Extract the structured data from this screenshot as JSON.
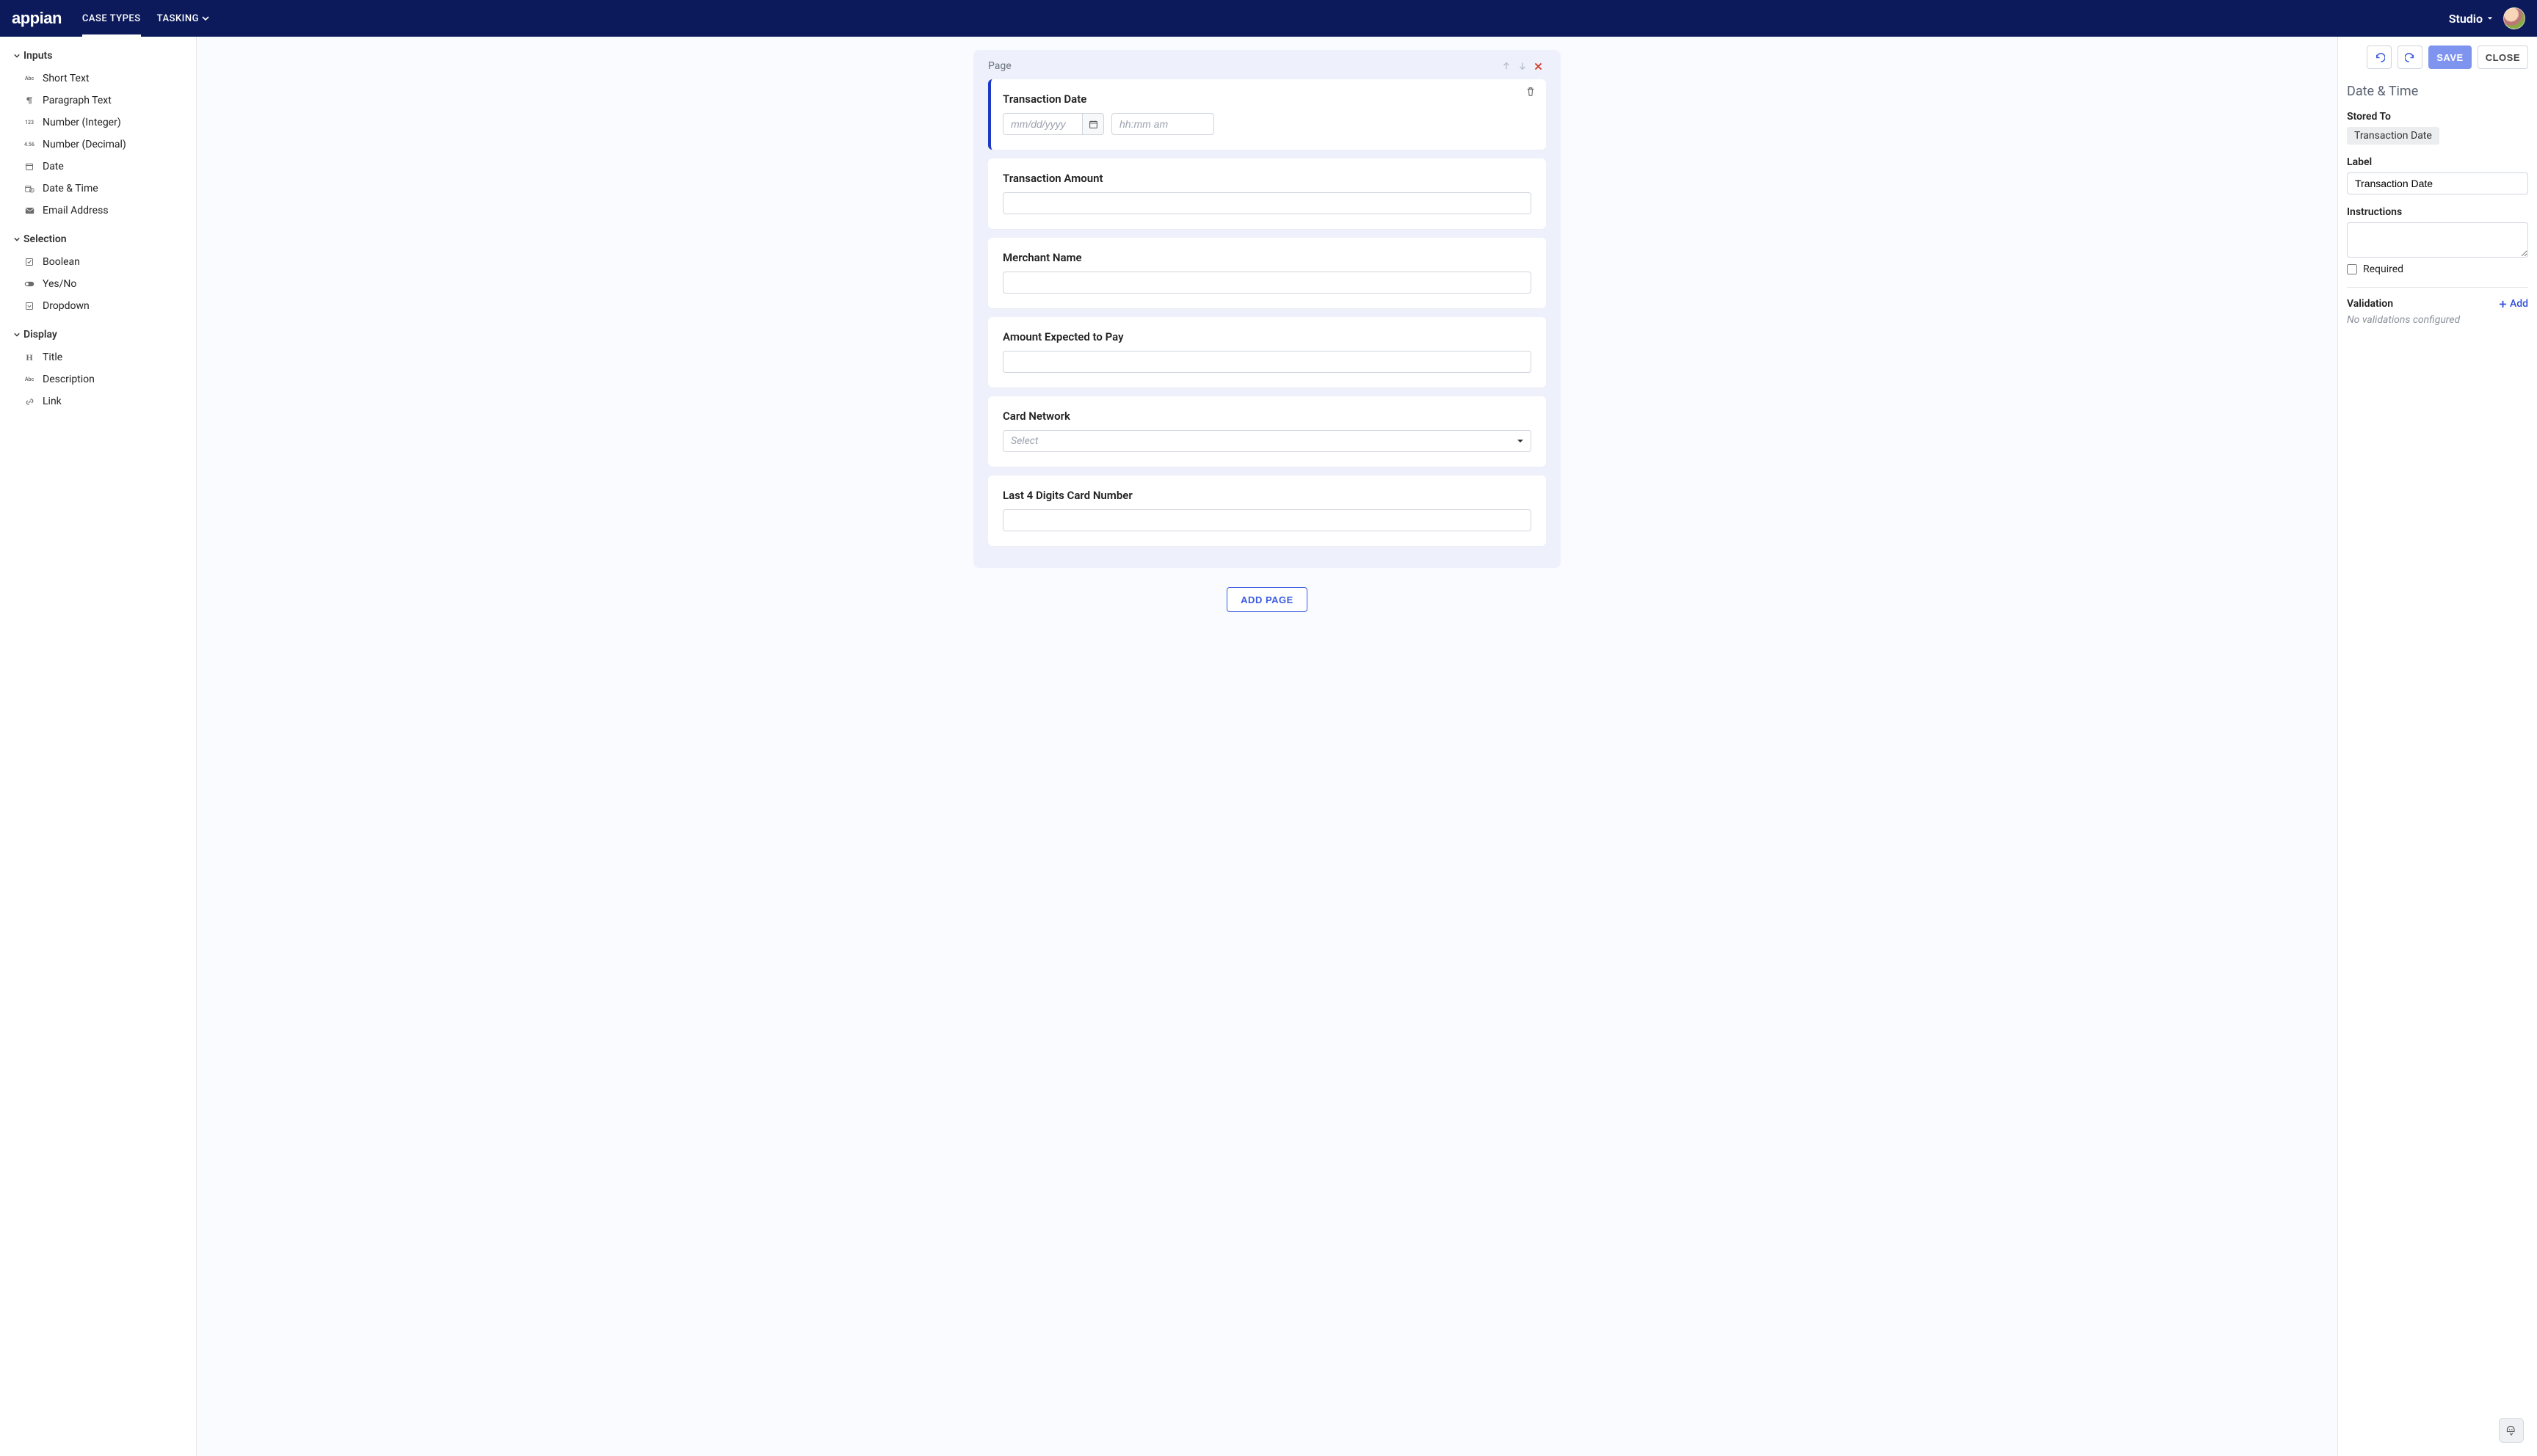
{
  "brand": "appian",
  "nav": {
    "items": [
      {
        "label": "CASE TYPES",
        "active": true
      },
      {
        "label": "TASKING",
        "caret": true
      }
    ],
    "right": {
      "label": "Studio"
    }
  },
  "palette": {
    "groups": [
      {
        "label": "Inputs",
        "items": [
          {
            "icon": "abc",
            "label": "Short Text"
          },
          {
            "icon": "para",
            "label": "Paragraph Text"
          },
          {
            "icon": "123",
            "label": "Number (Integer)"
          },
          {
            "icon": "456",
            "label": "Number (Decimal)"
          },
          {
            "icon": "cal",
            "label": "Date"
          },
          {
            "icon": "calt",
            "label": "Date & Time"
          },
          {
            "icon": "mail",
            "label": "Email Address"
          }
        ]
      },
      {
        "label": "Selection",
        "items": [
          {
            "icon": "check",
            "label": "Boolean"
          },
          {
            "icon": "toggle",
            "label": "Yes/No"
          },
          {
            "icon": "drop",
            "label": "Dropdown"
          }
        ]
      },
      {
        "label": "Display",
        "items": [
          {
            "icon": "H",
            "label": "Title"
          },
          {
            "icon": "abc",
            "label": "Description"
          },
          {
            "icon": "link",
            "label": "Link"
          }
        ]
      }
    ]
  },
  "canvas": {
    "page_header": "Page",
    "fields": [
      {
        "type": "datetime",
        "label": "Transaction Date",
        "date_placeholder": "mm/dd/yyyy",
        "time_placeholder": "hh:mm am",
        "selected": true
      },
      {
        "type": "text",
        "label": "Transaction Amount"
      },
      {
        "type": "text",
        "label": "Merchant Name"
      },
      {
        "type": "text",
        "label": "Amount Expected to Pay"
      },
      {
        "type": "select",
        "label": "Card Network",
        "placeholder": "Select"
      },
      {
        "type": "text",
        "label": "Last 4 Digits Card Number"
      }
    ],
    "add_page_label": "ADD PAGE"
  },
  "inspector": {
    "toolbar": {
      "save": "SAVE",
      "close": "CLOSE"
    },
    "title": "Date & Time",
    "stored_to_label": "Stored To",
    "stored_to_value": "Transaction Date",
    "label_label": "Label",
    "label_value": "Transaction Date",
    "instructions_label": "Instructions",
    "instructions_value": "",
    "required_label": "Required",
    "validation_label": "Validation",
    "add_label": "Add",
    "no_validations": "No validations configured"
  }
}
